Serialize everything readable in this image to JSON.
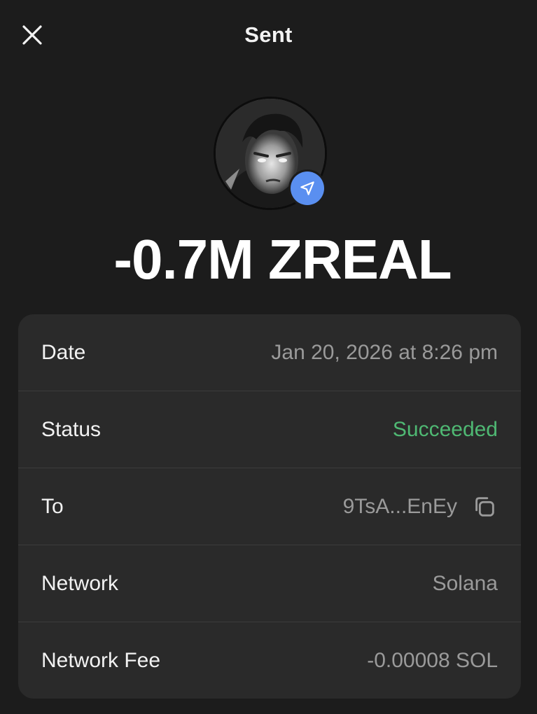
{
  "header": {
    "title": "Sent",
    "close_icon": "close-icon"
  },
  "avatar": {
    "badge_icon": "send-arrow-icon",
    "badge_color": "#5a8ff0"
  },
  "amount": "-0.7M ZREAL",
  "details": {
    "date_label": "Date",
    "date_value": "Jan 20, 2026 at 8:26 pm",
    "status_label": "Status",
    "status_value": "Succeeded",
    "status_color": "#4fb873",
    "to_label": "To",
    "to_value": "9TsA...EnEy",
    "to_copy_icon": "copy-icon",
    "network_label": "Network",
    "network_value": "Solana",
    "fee_label": "Network Fee",
    "fee_value": "-0.00008 SOL"
  }
}
